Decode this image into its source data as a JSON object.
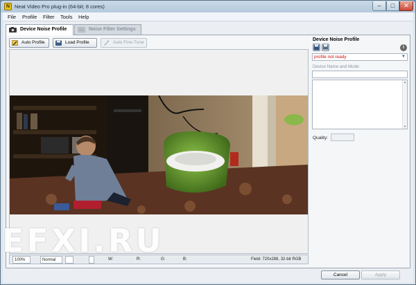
{
  "window": {
    "title": "Neat Video Pro plug-in (64-bit; 8 cores)",
    "controls": {
      "minimize": "–",
      "maximize": "□",
      "close": "✕"
    }
  },
  "menu": [
    "File",
    "Profile",
    "Filter",
    "Tools",
    "Help"
  ],
  "tabs": [
    {
      "label": "Device Noise Profile",
      "active": true
    },
    {
      "label": "Noise Filter Settings",
      "active": false
    }
  ],
  "toolbar": {
    "auto_profile": "Auto Profile",
    "load_profile": "Load Profile",
    "auto_fine_tune": "Auto Fine-Tune"
  },
  "statusbar": {
    "zoom": "100%",
    "mode": "Normal",
    "w_label": "W:",
    "r_label": "R:",
    "g_label": "G:",
    "b_label": "B:",
    "field_info": "Field: 720x288, 32-bit RGB"
  },
  "right_panel": {
    "title": "Device Noise Profile",
    "profile_status": "profile not ready",
    "device_label": "Device Name and Mode:",
    "quality_label": "Quality:",
    "info_glyph": "i"
  },
  "buttons": {
    "cancel": "Cancel",
    "apply": "Apply"
  },
  "watermark": "EFXI.RU",
  "colors": {
    "status_error": "#cc1111",
    "accent": "#2c5d9c"
  }
}
